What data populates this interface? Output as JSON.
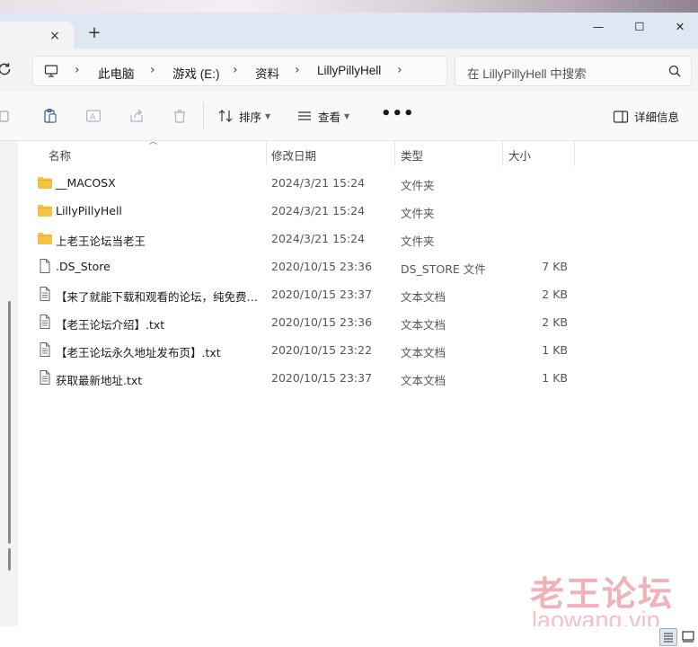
{
  "window": {
    "tab_close": "×",
    "new_tab": "+",
    "minimize": "—",
    "maximize": "☐",
    "close": "✕"
  },
  "address_bar": {
    "breadcrumb": [
      "此电脑",
      "游戏 (E:)",
      "资料",
      "LillyPillyHell"
    ],
    "separator": "›"
  },
  "search": {
    "placeholder": "在 LillyPillyHell 中搜索"
  },
  "command_bar": {
    "sort_label": "排序",
    "view_label": "查看",
    "more_label": "•••",
    "details_label": "详细信息"
  },
  "columns": {
    "name": "名称",
    "date": "修改日期",
    "type": "类型",
    "size": "大小"
  },
  "files": [
    {
      "name": "__MACOSX",
      "date": "2024/3/21 15:24",
      "type": "文件夹",
      "size": "",
      "kind": "folder"
    },
    {
      "name": "LillyPillyHell",
      "date": "2024/3/21 15:24",
      "type": "文件夹",
      "size": "",
      "kind": "folder"
    },
    {
      "name": "上老王论坛当老王",
      "date": "2024/3/21 15:24",
      "type": "文件夹",
      "size": "",
      "kind": "folder"
    },
    {
      "name": ".DS_Store",
      "date": "2020/10/15 23:36",
      "type": "DS_STORE 文件",
      "size": "7 KB",
      "kind": "file"
    },
    {
      "name": "【来了就能下载和观看的论坛，纯免费！...",
      "date": "2020/10/15 23:37",
      "type": "文本文档",
      "size": "2 KB",
      "kind": "text"
    },
    {
      "name": "【老王论坛介绍】.txt",
      "date": "2020/10/15 23:36",
      "type": "文本文档",
      "size": "2 KB",
      "kind": "text"
    },
    {
      "name": "【老王论坛永久地址发布页】.txt",
      "date": "2020/10/15 23:22",
      "type": "文本文档",
      "size": "1 KB",
      "kind": "text"
    },
    {
      "name": "获取最新地址.txt",
      "date": "2020/10/15 23:37",
      "type": "文本文档",
      "size": "1 KB",
      "kind": "text"
    }
  ],
  "watermark": {
    "line1": "老王论坛",
    "line2": "laowang.vip"
  },
  "colors": {
    "folder": "#f4c245",
    "accent": "#0067c0",
    "titlebar": "#dfe7f2"
  }
}
